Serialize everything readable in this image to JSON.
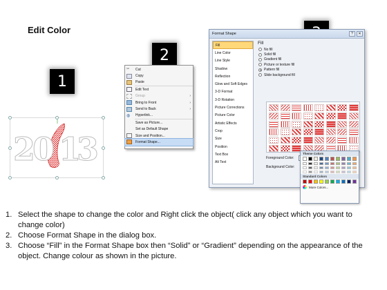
{
  "title": "Edit Color",
  "steps": [
    "1",
    "2",
    "3"
  ],
  "shape_text": "2013",
  "context_menu": {
    "items": [
      "Cut",
      "Copy",
      "Paste",
      "Edit Text",
      "Group",
      "Bring to Front",
      "Send to Back",
      "Hyperlink...",
      "Save as Picture...",
      "Set as Default Shape",
      "Size and Position...",
      "Format Shape..."
    ]
  },
  "dialog": {
    "title": "Format Shape",
    "nav": [
      "Fill",
      "Line Color",
      "Line Style",
      "Shadow",
      "Reflection",
      "Glow and Soft Edges",
      "3-D Format",
      "3-D Rotation",
      "Picture Corrections",
      "Picture Color",
      "Artistic Effects",
      "Crop",
      "Size",
      "Position",
      "Text Box",
      "Alt Text"
    ],
    "pane_title": "Fill",
    "options": [
      "No fill",
      "Solid fill",
      "Gradient fill",
      "Picture or texture fill",
      "Pattern fill",
      "Slide background fill"
    ],
    "foreground_label": "Foreground Color:",
    "background_label": "Background Color:",
    "close": "✕",
    "help": "?"
  },
  "palette": {
    "theme_label": "Theme Colors",
    "standard_label": "Standard Colors",
    "more_label": "More Colors...",
    "theme_colors": [
      "#ffffff",
      "#000000",
      "#eeece1",
      "#1f497d",
      "#4f81bd",
      "#c0504d",
      "#9bbb59",
      "#8064a2",
      "#4bacc6",
      "#f79646"
    ],
    "standard_colors": [
      "#c00000",
      "#ff0000",
      "#ffc000",
      "#ffff00",
      "#92d050",
      "#00b050",
      "#00b0f0",
      "#0070c0",
      "#002060",
      "#7030a0"
    ]
  },
  "colors": {
    "accent": "#e03a3a",
    "selected_nav": "#ffd87a",
    "menu_highlight": "#c7dcf5"
  },
  "instructions": [
    {
      "num": "1.",
      "text": "Select the shape to change the color and Right click the object( click any object which you want to change color)"
    },
    {
      "num": "2.",
      "text": "Choose Format Shape in the dialog box."
    },
    {
      "num": "3.",
      "text": "Choose “Fill” in the Format Shape box then “Solid” or “Gradient” depending on the appearance of the object. Change colour as shown in the picture."
    }
  ]
}
